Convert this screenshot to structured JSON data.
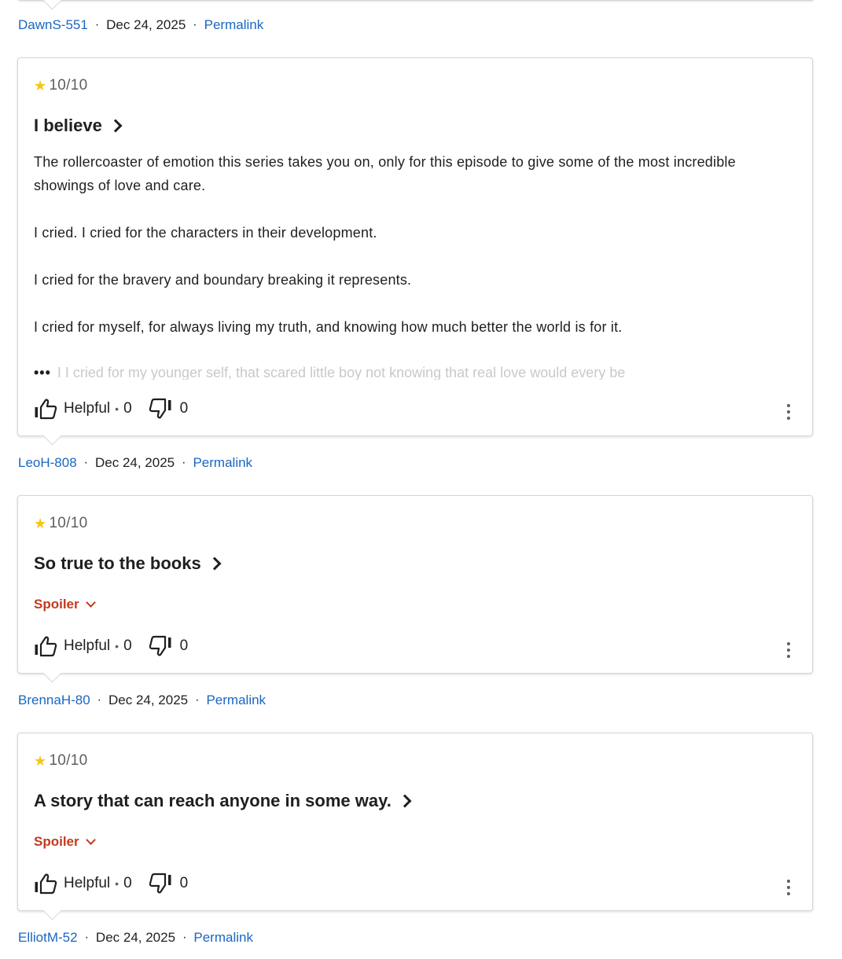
{
  "reviews_list": {
    "top_meta": {
      "author": "DawnS-551",
      "date": "Dec 24, 2025",
      "permalink": "Permalink"
    },
    "reviews": [
      {
        "rating": "10/10",
        "title": "I believe",
        "paragraphs": [
          "The rollercoaster of emotion this series takes you on, only for this episode to give some of the most incredible showings of love and care.",
          "I cried. I cried for the characters in their development.",
          "I cried for the bravery and boundary breaking it represents.",
          "I cried for myself, for always living my truth, and knowing how much better the world is for it."
        ],
        "truncated_text": "I I cried for my younger self, that scared little boy not knowing that real love would every be",
        "ellipsis": "•••",
        "helpful_label": "Helpful",
        "helpful_count": "0",
        "not_helpful_count": "0",
        "author": "LeoH-808",
        "date": "Dec 24, 2025",
        "permalink": "Permalink"
      },
      {
        "rating": "10/10",
        "title": "So true to the books",
        "spoiler_label": "Spoiler",
        "helpful_label": "Helpful",
        "helpful_count": "0",
        "not_helpful_count": "0",
        "author": "BrennaH-80",
        "date": "Dec 24, 2025",
        "permalink": "Permalink"
      },
      {
        "rating": "10/10",
        "title": "A story that can reach anyone in some way.",
        "spoiler_label": "Spoiler",
        "helpful_label": "Helpful",
        "helpful_count": "0",
        "not_helpful_count": "0",
        "author": "ElliotM-52",
        "date": "Dec 24, 2025",
        "permalink": "Permalink"
      }
    ]
  },
  "icons": {
    "star": "star-icon",
    "thumbs_up": "thumbs-up-icon",
    "thumbs_down": "thumbs-down-icon",
    "more": "more-vertical-icon",
    "chevron_right": "chevron-right-icon",
    "chevron_down": "chevron-down-icon"
  },
  "colors": {
    "link": "#1a66c2",
    "star": "#f5c518",
    "spoiler": "#c23a1e",
    "text": "#1f1f1f",
    "muted": "#5f5f5f"
  }
}
